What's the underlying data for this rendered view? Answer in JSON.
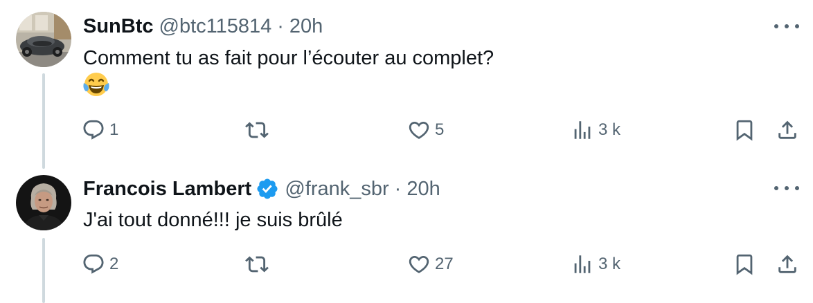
{
  "tweets": [
    {
      "name": "SunBtc",
      "handle": "@btc115814",
      "separator": "·",
      "time": "20h",
      "text": "Comment tu as fait pour l’écouter au complet?",
      "emoji": "joy-emoji",
      "verified": false,
      "stats": {
        "replies": "1",
        "retweets": "",
        "likes": "5",
        "views": "3 k"
      }
    },
    {
      "name": "Francois Lambert",
      "handle": "@frank_sbr",
      "separator": "·",
      "time": "20h",
      "text": "J'ai tout donné!!! je suis brûlé",
      "verified": true,
      "stats": {
        "replies": "2",
        "retweets": "",
        "likes": "27",
        "views": "3 k"
      }
    }
  ],
  "colors": {
    "text_primary": "#0f1419",
    "text_secondary": "#536471",
    "verified_blue": "#1d9bf0",
    "thread_line": "#cfd9de"
  }
}
